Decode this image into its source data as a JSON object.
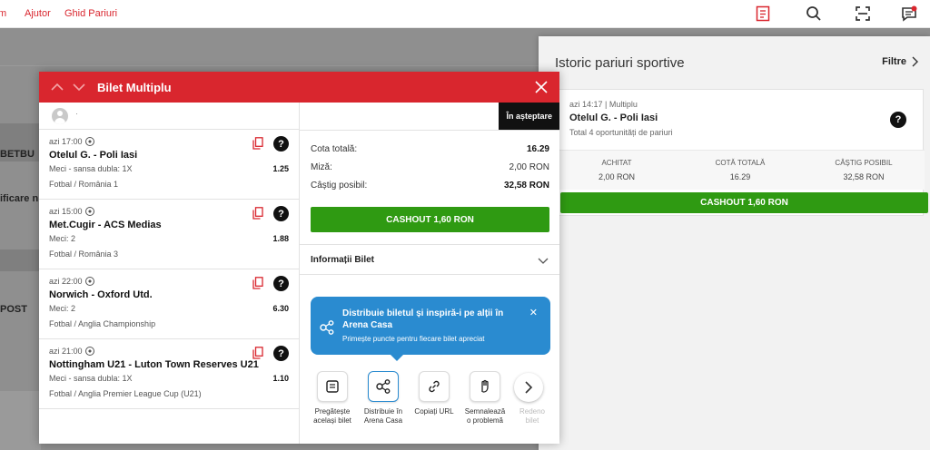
{
  "topnav": {
    "items": [
      "m",
      "Ajutor",
      "Ghid Pariuri"
    ]
  },
  "background": {
    "labels": [
      "BETBU",
      "ificare n",
      "POST"
    ]
  },
  "history": {
    "title": "Istoric pariuri sportive",
    "filter_label": "Filtre",
    "card": {
      "meta": "azi 14:17 | Multiplu",
      "match": "Otelul G. - Poli Iasi",
      "total": "Total 4 oportunități de pariuri",
      "cols": [
        {
          "label": "ACHITAT",
          "value": "2,00 RON"
        },
        {
          "label": "COTĂ TOTALĂ",
          "value": "16.29"
        },
        {
          "label": "CÂȘTIG POSIBIL",
          "value": "32,58 RON"
        }
      ],
      "cashout": "CASHOUT 1,60 RON"
    }
  },
  "modal": {
    "title": "Bilet Multiplu",
    "user_text": "·",
    "status": "În așteptare",
    "selections": [
      {
        "time": "azi 17:00",
        "match": "Otelul G. - Poli Iasi",
        "market": "Meci - sansa dubla: 1X",
        "odd": "1.25",
        "league": "Fotbal / România 1"
      },
      {
        "time": "azi 15:00",
        "match": "Met.Cugir - ACS Medias",
        "market": "Meci: 2",
        "odd": "1.88",
        "league": "Fotbal / România 3"
      },
      {
        "time": "azi 22:00",
        "match": "Norwich - Oxford Utd.",
        "market": "Meci: 2",
        "odd": "6.30",
        "league": "Fotbal / Anglia Championship"
      },
      {
        "time": "azi 21:00",
        "match": "Nottingham U21 - Luton Town Reserves U21",
        "market": "Meci - sansa dubla: 1X",
        "odd": "1.10",
        "league": "Fotbal / Anglia Premier League Cup (U21)"
      }
    ],
    "summary": {
      "total_odds_label": "Cota totală:",
      "total_odds": "16.29",
      "stake_label": "Miză:",
      "stake": "2,00 RON",
      "win_label": "Câștig posibil:",
      "win": "32,58 RON"
    },
    "cashout": "CASHOUT 1,60 RON",
    "info_label": "Informații Bilet",
    "share": {
      "title": "Distribuie biletul și inspiră-i pe alții în Arena Casa",
      "subtitle": "Primește puncte pentru fiecare bilet apreciat"
    },
    "actions": [
      {
        "label1": "Pregătește",
        "label2": "același bilet"
      },
      {
        "label1": "Distribuie în",
        "label2": "Arena Casa"
      },
      {
        "label1": "Copiați URL",
        "label2": ""
      },
      {
        "label1": "Semnalează",
        "label2": "o problemă"
      },
      {
        "label1": "Redeno",
        "label2": "bilet"
      }
    ]
  },
  "colors": {
    "brand_red": "#d9262e",
    "cashout_green": "#2f9a12",
    "share_blue": "#2a8bd0"
  }
}
